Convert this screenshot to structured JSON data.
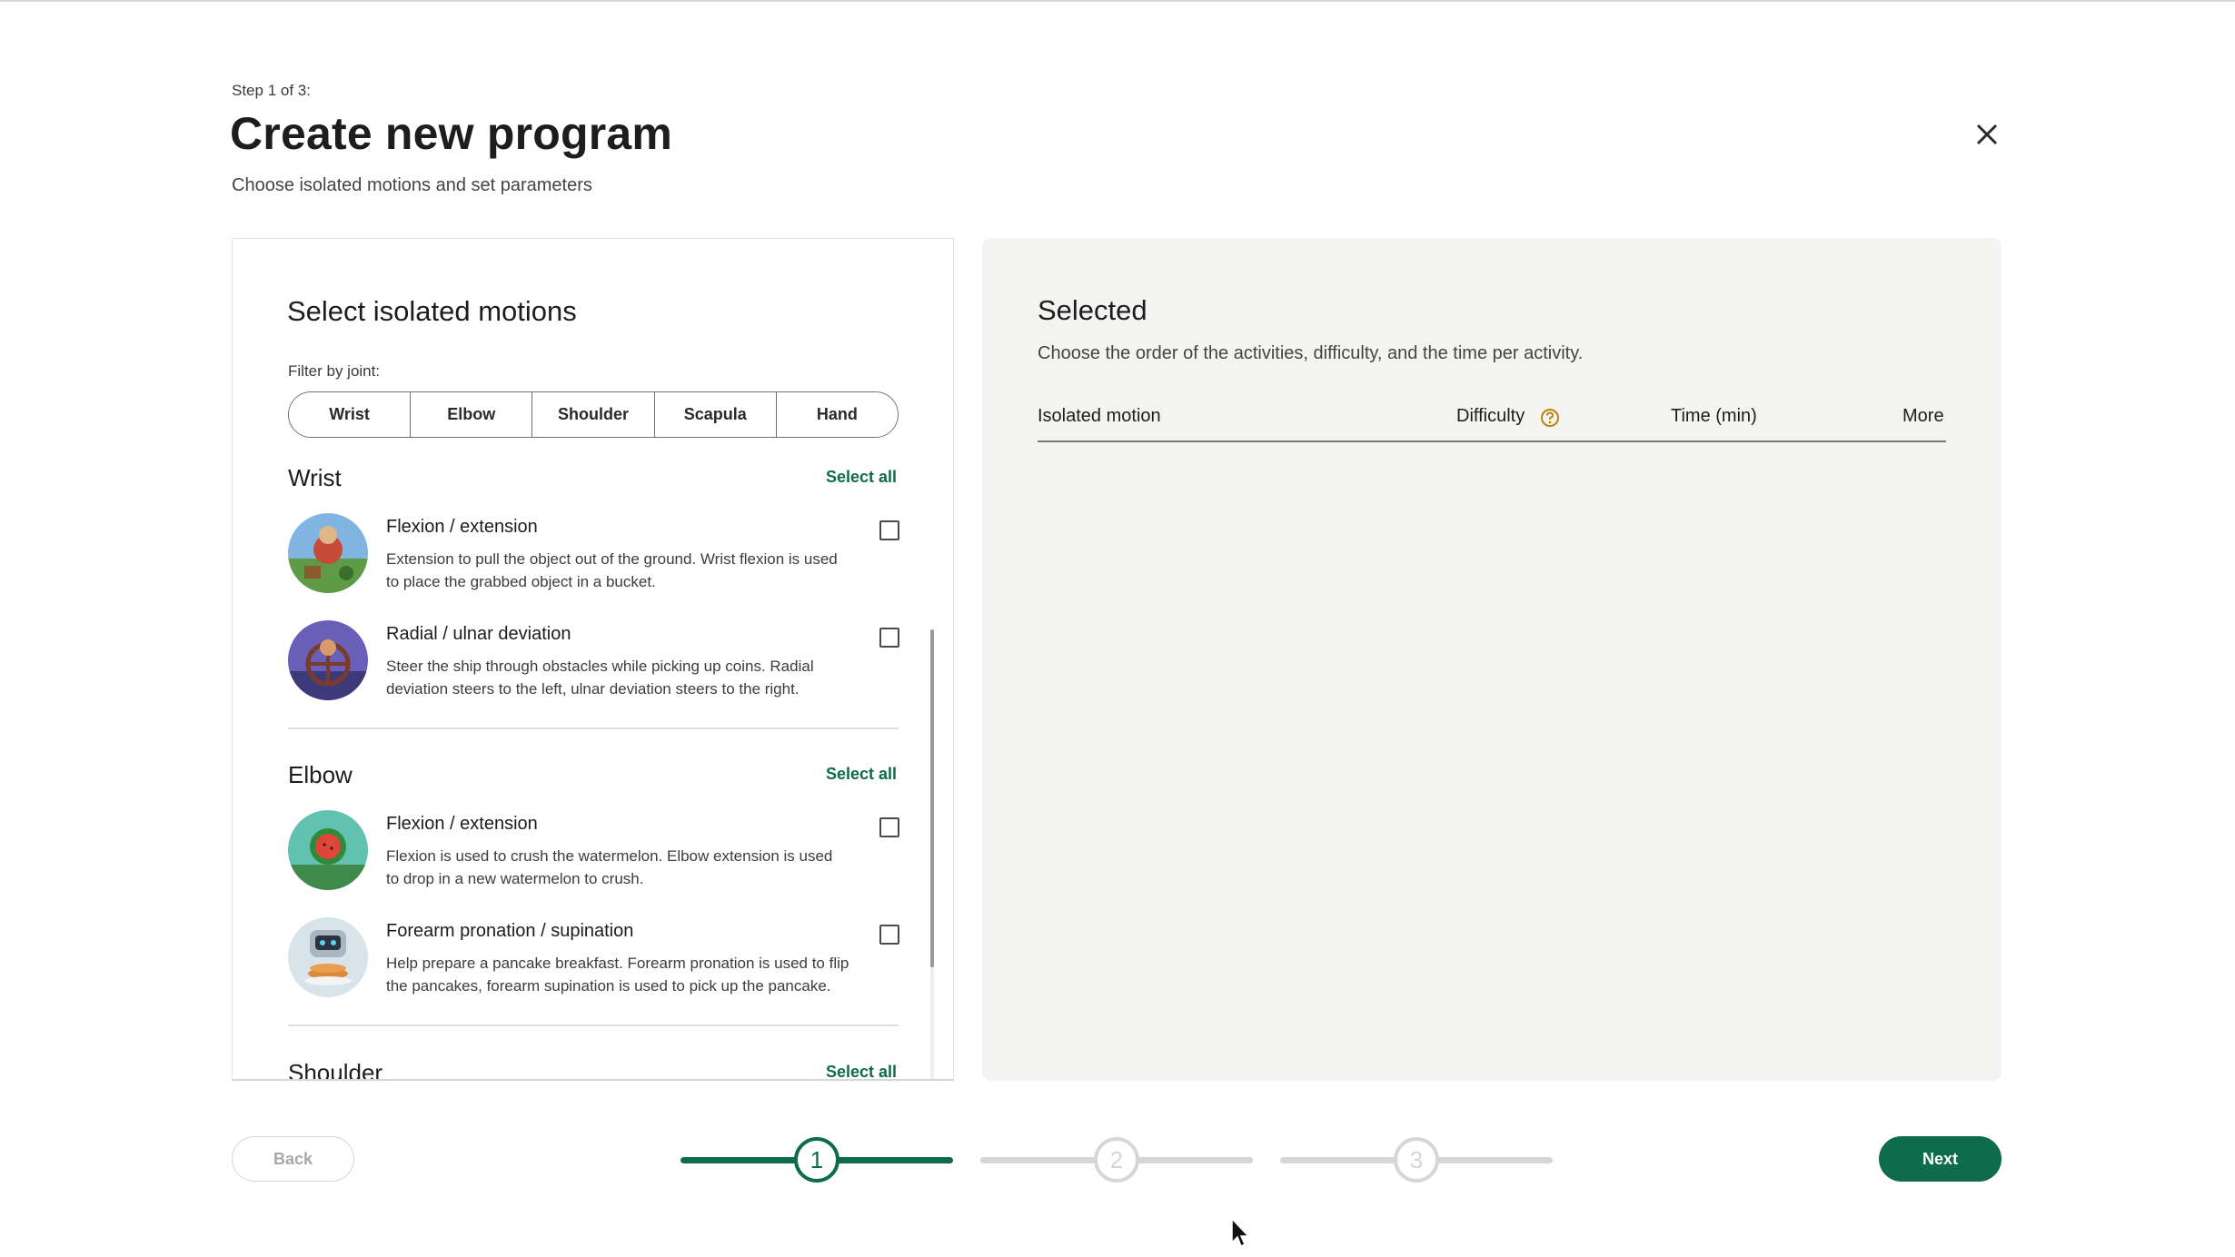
{
  "header": {
    "step_label": "Step 1 of 3:",
    "title": "Create new program",
    "subtitle": "Choose isolated motions and set parameters",
    "close_icon": "close-icon"
  },
  "left_panel": {
    "title": "Select isolated motions",
    "filter_label": "Filter by joint:",
    "filters": [
      "Wrist",
      "Elbow",
      "Shoulder",
      "Scapula",
      "Hand"
    ],
    "sections": [
      {
        "title": "Wrist",
        "select_all": "Select all",
        "items": [
          {
            "title": "Flexion / extension",
            "description": "Extension to pull the object out of the ground. Wrist flexion is used to place the grabbed object in a bucket.",
            "checked": false
          },
          {
            "title": "Radial / ulnar deviation",
            "description": "Steer the ship through obstacles while picking up coins. Radial deviation steers to the left, ulnar deviation steers to the right.",
            "checked": false
          }
        ]
      },
      {
        "title": "Elbow",
        "select_all": "Select all",
        "items": [
          {
            "title": "Flexion / extension",
            "description": "Flexion is used to crush the watermelon. Elbow extension is used to drop in a new watermelon to crush.",
            "checked": false
          },
          {
            "title": "Forearm pronation / supination",
            "description": "Help prepare a pancake breakfast. Forearm pronation is used to flip the pancakes, forearm supination is used to pick up the pancake.",
            "checked": false
          }
        ]
      },
      {
        "title": "Shoulder",
        "select_all": "Select all",
        "items": []
      }
    ]
  },
  "right_panel": {
    "title": "Selected",
    "subtitle": "Choose the order of the activities, difficulty, and the time per activity.",
    "columns": [
      "Isolated motion",
      "Difficulty",
      "Time (min)",
      "More"
    ],
    "help_icon": "question-icon",
    "rows": []
  },
  "footer": {
    "back_label": "Back",
    "next_label": "Next",
    "steps": [
      "1",
      "2",
      "3"
    ],
    "current_step": 1
  },
  "colors": {
    "accent": "#0e6b4c",
    "inactive": "#d6d6d6",
    "help": "#b8860b"
  }
}
